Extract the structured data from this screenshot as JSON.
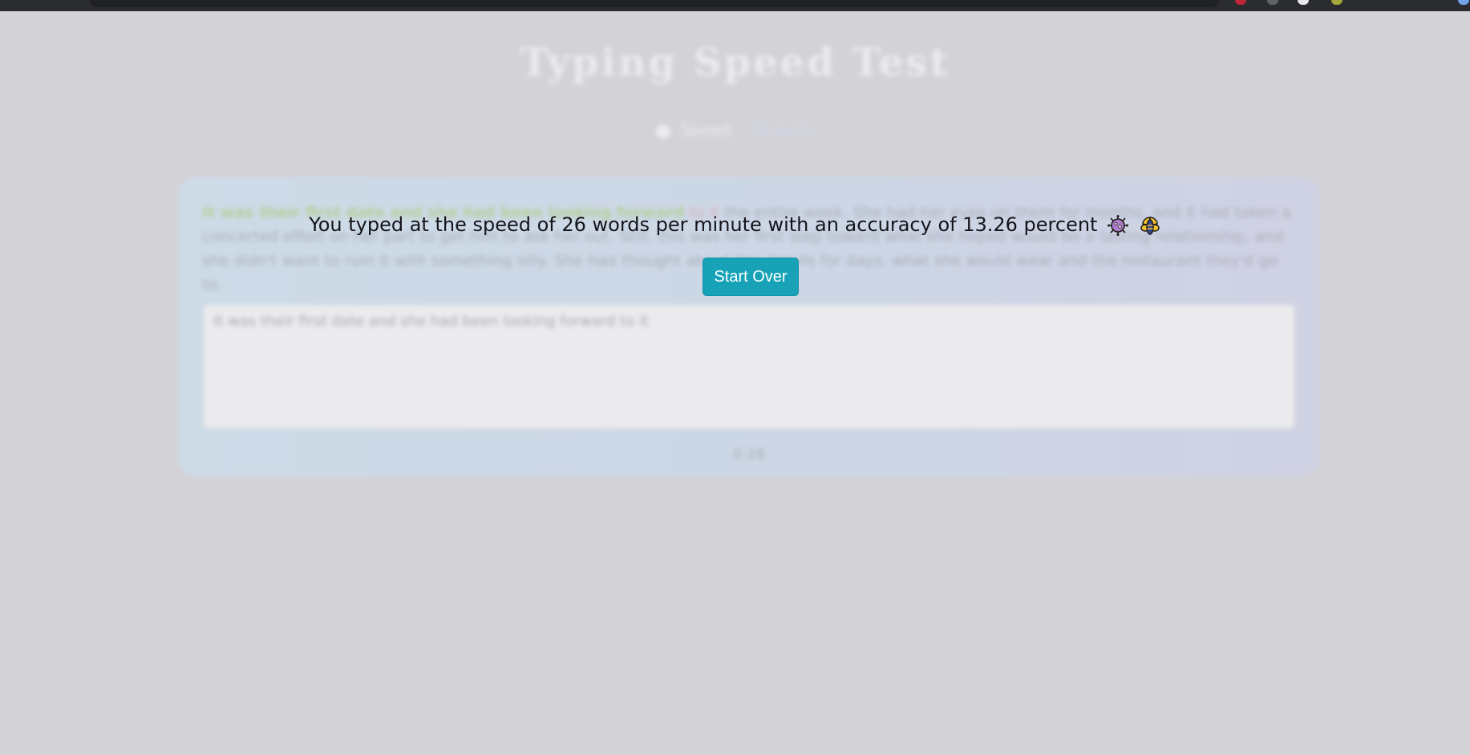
{
  "app": {
    "title": "Typing Speed Test",
    "speed_label": "Speed:",
    "speed_value": "26 wpm"
  },
  "passage": {
    "typed_correct": "It was their first date and she had been looking forward",
    "typed_wrong": "to it",
    "remaining": "the entire week. She had her eyes on them for months, and it had taken a concerted effort on her part to get him to ask her out. Still, this was her first step toward what she hoped would be a lasting relationship, and she didn't want to ruin it with something silly. She had thought about the details for days, what she would wear and the restaurant they'd go to.",
    "input_value": "It was their first date and she had been looking forward to it"
  },
  "timer": "0:28",
  "result": {
    "message": "You typed at the speed of 26 words per minute with an accuracy of 13.26 percent",
    "emoji_1": "virus-icon",
    "emoji_2": "bee-icon",
    "button_label": "Start Over"
  },
  "colors": {
    "overlay_bg": "#d3d2d7",
    "button_bg": "#17a2b8",
    "button_text": "#ffffff",
    "result_text": "#14141a",
    "correct_text": "#9acd6a",
    "wrong_text": "#e08a9a"
  }
}
